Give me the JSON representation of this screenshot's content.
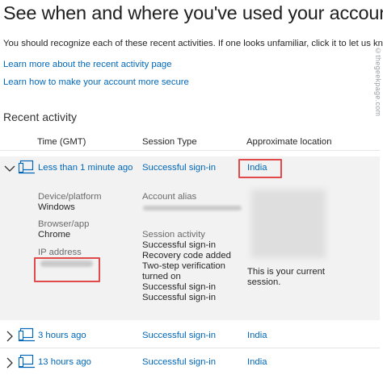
{
  "page": {
    "title": "See when and where you've used your account",
    "subtitle": "You should recognize each of these recent activities. If one looks unfamiliar, click it to let us know.",
    "links": [
      "Learn more about the recent activity page",
      "Learn how to make your account more secure"
    ],
    "watermark": "©thegeekpage.com"
  },
  "recent_activity": {
    "heading": "Recent activity",
    "columns": {
      "time": "Time (GMT)",
      "session_type": "Session Type",
      "location": "Approximate location"
    },
    "rows": [
      {
        "time": "Less than 1 minute ago",
        "session_type": "Successful sign-in",
        "location": "India",
        "expanded": true
      },
      {
        "time": "3 hours ago",
        "session_type": "Successful sign-in",
        "location": "India",
        "expanded": false
      },
      {
        "time": "13 hours ago",
        "session_type": "Successful sign-in",
        "location": "India",
        "expanded": false
      }
    ],
    "details": {
      "device_label": "Device/platform",
      "device_value": "Windows",
      "browser_label": "Browser/app",
      "browser_value": "Chrome",
      "ip_label": "IP address",
      "alias_label": "Account alias",
      "session_activity_label": "Session activity",
      "session_activity": [
        "Successful sign-in",
        "Recovery code added",
        "Two-step verification",
        "turned on",
        "Successful sign-in",
        "Successful sign-in"
      ],
      "current_session_line1": "This is your current",
      "current_session_line2": "session."
    }
  },
  "colors": {
    "link": "#0067b8",
    "highlight": "#e04a4a",
    "expanded_bg": "#f2f2f2"
  }
}
